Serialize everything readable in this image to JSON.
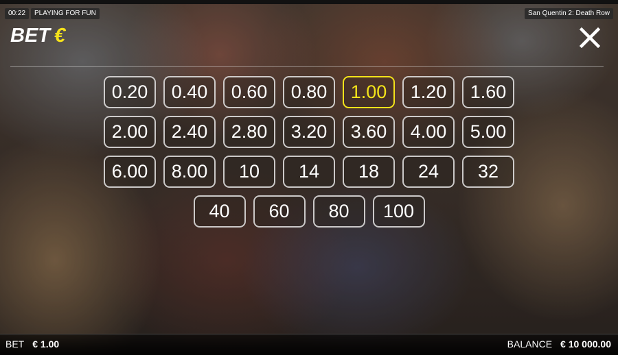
{
  "header": {
    "timer": "00:22",
    "mode_label": "PLAYING FOR FUN",
    "game_title": "San Quentin 2: Death Row"
  },
  "panel": {
    "title": "BET",
    "currency_symbol": "€",
    "close_icon": "close-icon"
  },
  "bet_options": {
    "rows": [
      [
        "0.20",
        "0.40",
        "0.60",
        "0.80",
        "1.00",
        "1.20",
        "1.60"
      ],
      [
        "2.00",
        "2.40",
        "2.80",
        "3.20",
        "3.60",
        "4.00",
        "5.00"
      ],
      [
        "6.00",
        "8.00",
        "10",
        "14",
        "18",
        "24",
        "32"
      ],
      [
        "40",
        "60",
        "80",
        "100"
      ]
    ],
    "selected": "1.00"
  },
  "footer": {
    "bet_label": "BET",
    "bet_value": "€ 1.00",
    "balance_label": "BALANCE",
    "balance_value": "€ 10 000.00"
  },
  "colors": {
    "accent_selected": "#f3e31a",
    "button_border": "#e6e6e6",
    "text": "#ffffff"
  }
}
